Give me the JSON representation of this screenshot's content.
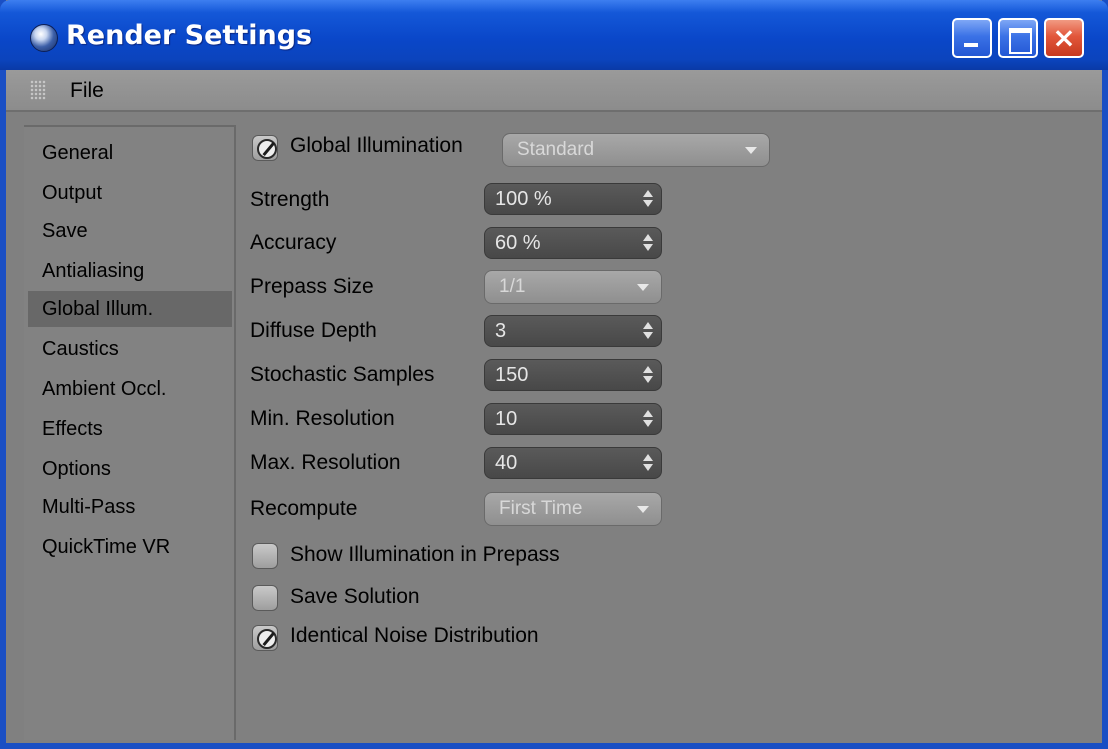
{
  "window": {
    "title": "Render Settings"
  },
  "menu": {
    "file": "File"
  },
  "sidebar": {
    "items": [
      {
        "label": "General"
      },
      {
        "label": "Output"
      },
      {
        "label": "Save"
      },
      {
        "label": "Antialiasing"
      },
      {
        "label": "Global Illum."
      },
      {
        "label": "Caustics"
      },
      {
        "label": "Ambient Occl."
      },
      {
        "label": "Effects"
      },
      {
        "label": "Options"
      },
      {
        "label": "Multi-Pass"
      },
      {
        "label": "QuickTime VR"
      }
    ],
    "active": "Global Illum."
  },
  "gi": {
    "enable_label": "Global Illumination",
    "enabled": true,
    "mode_value": "Standard",
    "strength_label": "Strength",
    "strength_value": "100 %",
    "accuracy_label": "Accuracy",
    "accuracy_value": "60 %",
    "prepass_label": "Prepass Size",
    "prepass_value": "1/1",
    "diffuse_label": "Diffuse Depth",
    "diffuse_value": "3",
    "stochastic_label": "Stochastic Samples",
    "stochastic_value": "150",
    "minres_label": "Min. Resolution",
    "minres_value": "10",
    "maxres_label": "Max. Resolution",
    "maxres_value": "40",
    "recompute_label": "Recompute",
    "recompute_value": "First Time",
    "show_illum_label": "Show Illumination in Prepass",
    "show_illum_checked": false,
    "save_solution_label": "Save Solution",
    "save_solution_checked": false,
    "identical_noise_label": "Identical Noise Distribution",
    "identical_noise_checked": true
  }
}
